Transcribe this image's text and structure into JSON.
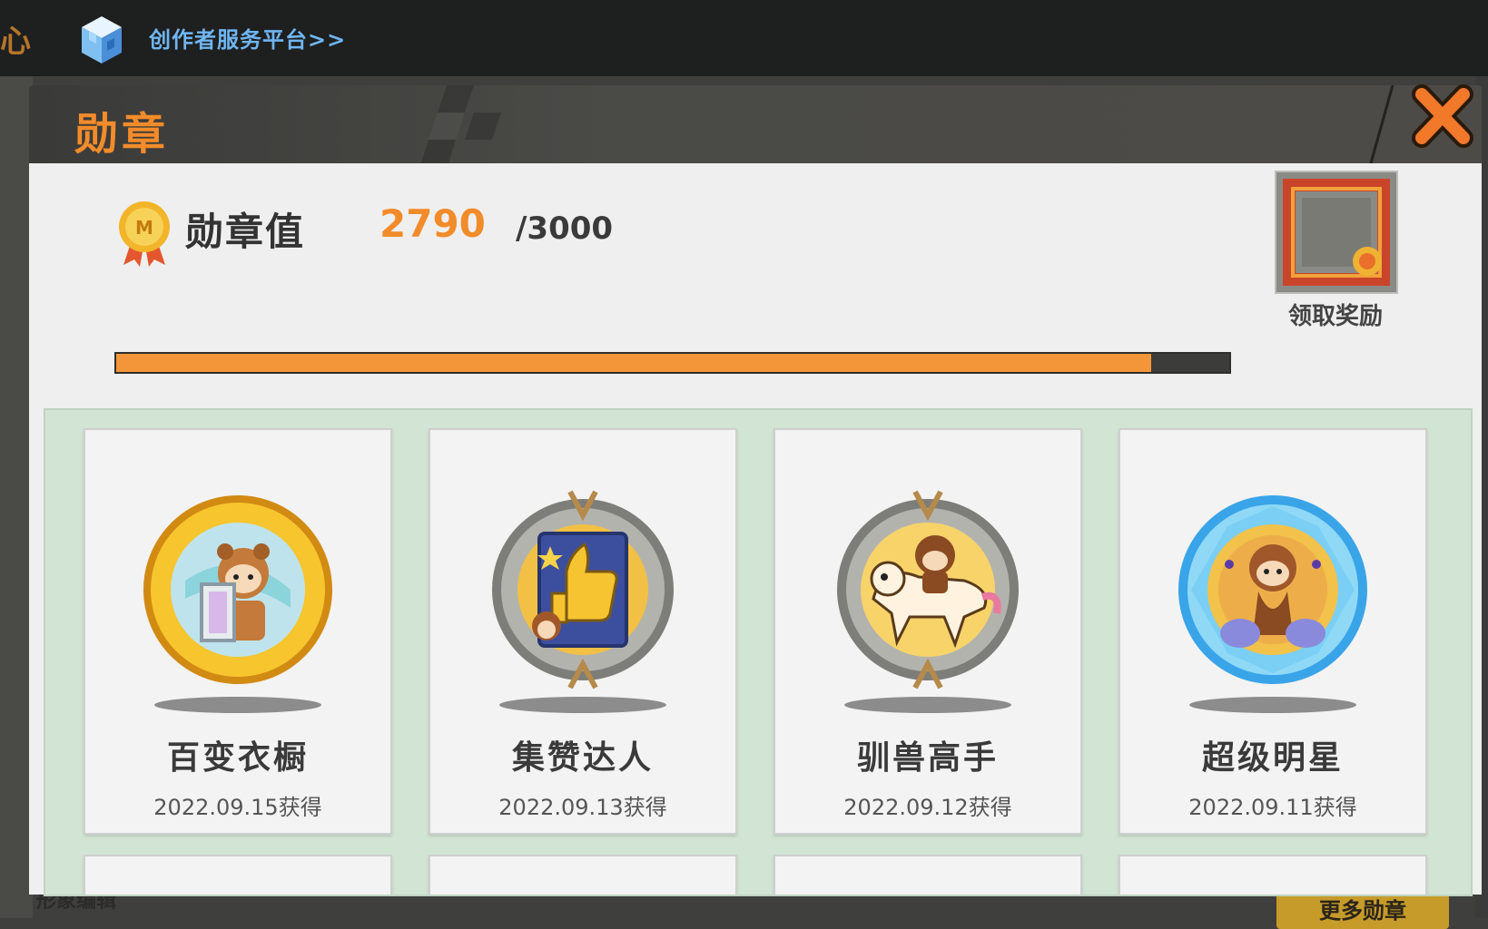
{
  "topbar": {
    "edge_char": "心",
    "creator_link": "创作者服务平台>>"
  },
  "background": {
    "under_text": "形象编辑",
    "more_button": "更多勋章"
  },
  "dialog": {
    "title": "勋章",
    "close_icon": "close-x-icon",
    "medal_value_label": "勋章值",
    "current_value": "2790",
    "max_value": "/3000",
    "progress_fraction": 0.93,
    "reward_label": "领取奖励",
    "colors": {
      "accent": "#f28b2a",
      "progress": "#f39639",
      "grid_bg": "#d2e4d3"
    },
    "medals": [
      {
        "name": "百变衣橱",
        "date": "2022.09.15获得",
        "icon": "wardrobe-gold-medal-icon"
      },
      {
        "name": "集赞达人",
        "date": "2022.09.13获得",
        "icon": "thumbs-up-stone-medal-icon"
      },
      {
        "name": "驯兽高手",
        "date": "2022.09.12获得",
        "icon": "beast-rider-stone-medal-icon"
      },
      {
        "name": "超级明星",
        "date": "2022.09.11获得",
        "icon": "superstar-crystal-medal-icon"
      }
    ]
  }
}
